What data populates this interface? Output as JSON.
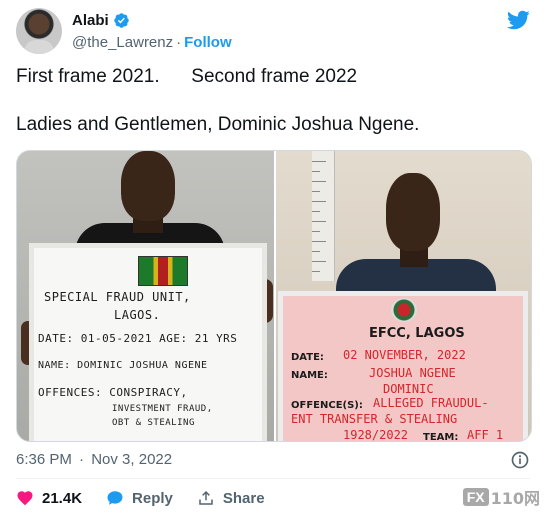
{
  "author": {
    "name": "Alabi",
    "handle": "@the_Lawrenz",
    "separator": "·",
    "follow_label": "Follow"
  },
  "tweet": {
    "line1": "First frame 2021.      Second frame 2022",
    "line2": "Ladies and Gentlemen, Dominic Joshua Ngene."
  },
  "media": {
    "left_board": {
      "line1": "SPECIAL FRAUD UNIT,",
      "line2": "LAGOS.",
      "date_line": "DATE: 01-05-2021 AGE: 21 YRS",
      "name_line": "NAME: DOMINIC JOSHUA NGENE",
      "offences_line": "OFFENCES: CONSPIRACY,",
      "offences_line2": "INVESTMENT FRAUD,",
      "offences_line3": "OBT & STEALING"
    },
    "right_board": {
      "title": "EFCC, LAGOS",
      "date_label": "DATE:",
      "date_value": "02 NOVEMBER, 2022",
      "name_label": "NAME:",
      "name_value": "JOSHUA NGENE",
      "name_value2": "DOMINIC",
      "offence_label": "OFFENCE(S):",
      "offence_value": "ALLEGED FRAUDUL-",
      "offence_value2": "ENT TRANSFER & STEALING",
      "bottom_line": "1928/2022",
      "team_label": "TEAM:",
      "team_value": "AFF 1"
    }
  },
  "meta": {
    "time": "6:36 PM",
    "separator": "·",
    "date": "Nov 3, 2022"
  },
  "actions": {
    "likes": "21.4K",
    "reply_label": "Reply",
    "share_label": "Share"
  },
  "watermark": {
    "box": "FX",
    "text": "110网"
  },
  "colors": {
    "twitter_blue": "#1d9bf0",
    "like_pink": "#f91880",
    "secondary_text": "#536471"
  }
}
